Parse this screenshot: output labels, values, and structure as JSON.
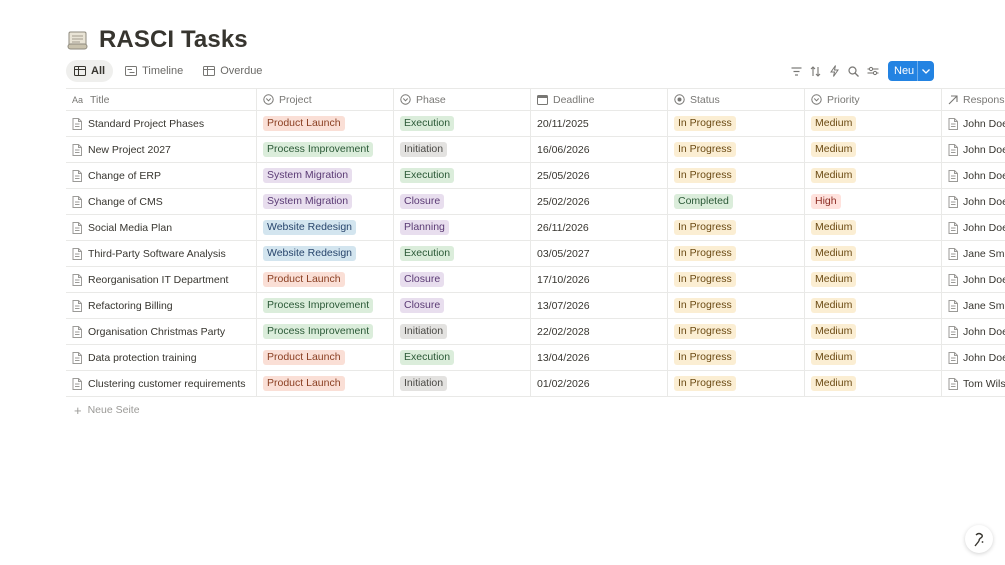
{
  "page": {
    "title": "RASCI Tasks",
    "icon": "scroll-icon"
  },
  "views": [
    {
      "label": "All",
      "icon": "table-icon",
      "active": true
    },
    {
      "label": "Timeline",
      "icon": "timeline-icon",
      "active": false
    },
    {
      "label": "Overdue",
      "icon": "table-icon",
      "active": false
    }
  ],
  "toolbar": {
    "icons": [
      "filter-icon",
      "sort-icon",
      "automation-icon",
      "search-icon",
      "settings-icon"
    ],
    "new_label": "Neu"
  },
  "columns": {
    "title": "Title",
    "project": "Project",
    "phase": "Phase",
    "deadline": "Deadline",
    "status": "Status",
    "priority": "Priority",
    "responsible": "Responsibl"
  },
  "rows": [
    {
      "title": "Standard Project Phases",
      "project": "Product Launch",
      "phase": "Execution",
      "deadline": "20/11/2025",
      "status": "In Progress",
      "priority": "Medium",
      "responsible": "John Doe"
    },
    {
      "title": "New Project 2027",
      "project": "Process Improvement",
      "phase": "Initiation",
      "deadline": "16/06/2026",
      "status": "In Progress",
      "priority": "Medium",
      "responsible": "John Doe"
    },
    {
      "title": "Change of ERP",
      "project": "System Migration",
      "phase": "Execution",
      "deadline": "25/05/2026",
      "status": "In Progress",
      "priority": "Medium",
      "responsible": "John Doe"
    },
    {
      "title": "Change of CMS",
      "project": "System Migration",
      "phase": "Closure",
      "deadline": "25/02/2026",
      "status": "Completed",
      "priority": "High",
      "responsible": "John Doe"
    },
    {
      "title": "Social Media Plan",
      "project": "Website Redesign",
      "phase": "Planning",
      "deadline": "26/11/2026",
      "status": "In Progress",
      "priority": "Medium",
      "responsible": "John Doe"
    },
    {
      "title": "Third-Party Software Analysis",
      "project": "Website Redesign",
      "phase": "Execution",
      "deadline": "03/05/2027",
      "status": "In Progress",
      "priority": "Medium",
      "responsible": "Jane Smi"
    },
    {
      "title": "Reorganisation IT Department",
      "project": "Product Launch",
      "phase": "Closure",
      "deadline": "17/10/2026",
      "status": "In Progress",
      "priority": "Medium",
      "responsible": "John Doe"
    },
    {
      "title": "Refactoring Billing",
      "project": "Process Improvement",
      "phase": "Closure",
      "deadline": "13/07/2026",
      "status": "In Progress",
      "priority": "Medium",
      "responsible": "Jane Smi"
    },
    {
      "title": "Organisation Christmas Party",
      "project": "Process Improvement",
      "phase": "Initiation",
      "deadline": "22/02/2028",
      "status": "In Progress",
      "priority": "Medium",
      "responsible": "John Doe"
    },
    {
      "title": "Data protection training",
      "project": "Product Launch",
      "phase": "Execution",
      "deadline": "13/04/2026",
      "status": "In Progress",
      "priority": "Medium",
      "responsible": "John Doe"
    },
    {
      "title": "Clustering customer requirements",
      "project": "Product Launch",
      "phase": "Initiation",
      "deadline": "01/02/2026",
      "status": "In Progress",
      "priority": "Medium",
      "responsible": "Tom Wils"
    }
  ],
  "new_page_label": "Neue Seite",
  "tag_colors": {
    "Product Launch": {
      "bg": "#fadfd6",
      "fg": "#8a3f22"
    },
    "Process Improvement": {
      "bg": "#dbeddb",
      "fg": "#2b5937"
    },
    "System Migration": {
      "bg": "#e8deee",
      "fg": "#5a3a74"
    },
    "Website Redesign": {
      "bg": "#d3e5ef",
      "fg": "#28456c"
    },
    "Execution": {
      "bg": "#dbeddb",
      "fg": "#2b5937"
    },
    "Initiation": {
      "bg": "#e3e2e0",
      "fg": "#4a4945"
    },
    "Closure": {
      "bg": "#e8deee",
      "fg": "#5a3a74"
    },
    "Planning": {
      "bg": "#e8deee",
      "fg": "#5a3a74"
    },
    "In Progress": {
      "bg": "#fbeed3",
      "fg": "#6b4a13"
    },
    "Completed": {
      "bg": "#dbeddb",
      "fg": "#2b5937"
    },
    "Medium": {
      "bg": "#fbeed3",
      "fg": "#6b4a13"
    },
    "High": {
      "bg": "#ffe2dd",
      "fg": "#8c2c24"
    }
  },
  "accent_color": "#2383e2"
}
